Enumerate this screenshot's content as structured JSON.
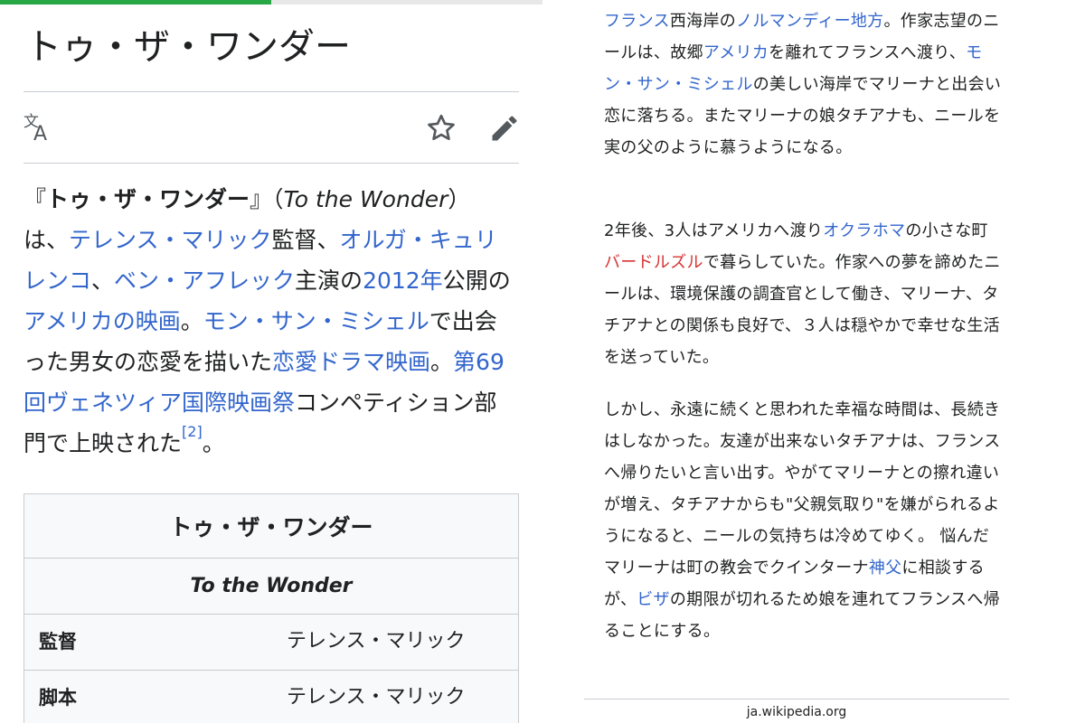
{
  "article": {
    "title": "トゥ・ザ・ワンダー",
    "reading_progress_percent": 50
  },
  "toolbar": {
    "language_icon": "translate-icon",
    "watch_icon": "star-outline-icon",
    "edit_icon": "pencil-icon"
  },
  "lead": {
    "open_bracket": "『",
    "title_bold": "トゥ・ザ・ワンダー",
    "close_bracket": "』",
    "paren_open": "（",
    "original_title": "To the Wonder",
    "paren_close": "）",
    "t1": "は、",
    "link_director": "テレンス・マリック",
    "t2": "監督、",
    "link_actor1": "オルガ・キュリレンコ",
    "t3": "、",
    "link_actor2": "ベン・アフレック",
    "t4": "主演の",
    "link_year": "2012年",
    "t5": "公開の",
    "link_film": "アメリカの映画",
    "t6": "。",
    "link_place": "モン・サン・ミシェル",
    "t7": "で出会った男女の恋愛を描いた",
    "link_genre": "恋愛ドラマ映画",
    "t8": "。",
    "link_festival": "第69回ヴェネツィア国際映画祭",
    "t9": "コンペティション部門で上映された",
    "ref": "[2]",
    "t10": "。"
  },
  "infobox": {
    "title": "トゥ・ザ・ワンダー",
    "original_title": "To the Wonder",
    "rows": [
      {
        "label": "監督",
        "value": "テレンス・マリック",
        "is_link": true
      },
      {
        "label": "脚本",
        "value": "テレンス・マリック",
        "is_link": false
      }
    ]
  },
  "plot": {
    "p1": {
      "link_france": "フランス",
      "a": "西海岸の",
      "link_normandy": "ノルマンディー地方",
      "b": "。作家志望のニールは、故郷",
      "link_america": "アメリカ",
      "c": "を離れてフランスへ渡り、",
      "link_msm": "モン・サン・ミシェル",
      "d": "の美しい海岸でマリーナと出会い恋に落ちる。またマリーナの娘タチアナも、ニールを実の父のように慕うようになる。"
    },
    "p2": {
      "a": "2年後、3人はアメリカへ渡り",
      "link_oklahoma": "オクラホマ",
      "b": "の小さな町",
      "redlink_town": "バードルズル",
      "c": "で暮らしていた。作家への夢を諦めたニールは、環境保護の調査官として働き、マリーナ、タチアナとの関係も良好で、３人は穏やかで幸せな生活を送っていた。"
    },
    "p3": {
      "a": "しかし、永遠に続くと思われた幸福な時間は、長続きはしなかった。友達が出来ないタチアナは、フランスへ帰りたいと言い出す。やがてマリーナとの擦れ違いが増え、タチアナからも\"父親気取り\"を嫌がられるようになると、ニールの気持ちは冷めてゆく。 悩んだマリーナは町の教会でクインターナ",
      "link_priest": "神父",
      "b": "に相談するが、",
      "link_visa": "ビザ",
      "c": "の期限が切れるため娘を連れてフランスへ帰ることにする。"
    }
  },
  "footer": {
    "domain": "ja.wikipedia.org"
  },
  "colors": {
    "link": "#3366cc",
    "redlink": "#d73333",
    "progress": "#28a745",
    "text": "#202122",
    "border": "#c8ccd1",
    "infobox_bg": "#f8f9fa"
  }
}
